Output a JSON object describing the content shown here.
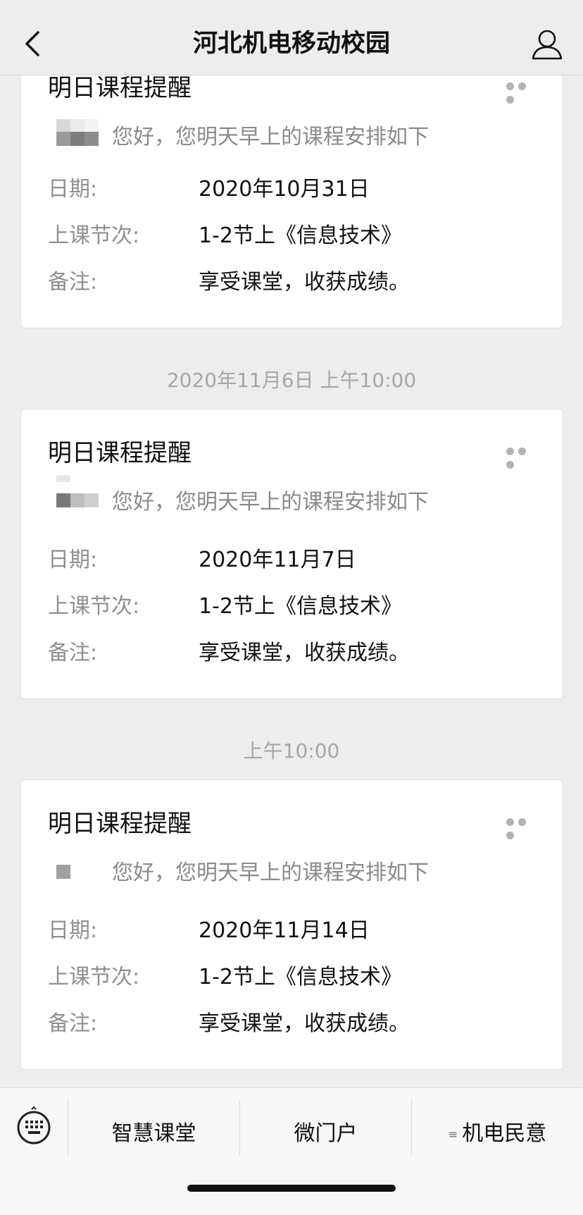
{
  "nav": {
    "title": "河北机电移动校园"
  },
  "messages": [
    {
      "title": "明日课程提醒",
      "greeting": "您好，您明天早上的课程安排如下",
      "date_label": "日期:",
      "date": "2020年10月31日",
      "session_label": "上课节次:",
      "session": "1-2节上《信息技术》",
      "note_label": "备注:",
      "note": "享受课堂，收获成绩。"
    },
    {
      "title": "明日课程提醒",
      "greeting": "您好，您明天早上的课程安排如下",
      "date_label": "日期:",
      "date": "2020年11月7日",
      "session_label": "上课节次:",
      "session": "1-2节上《信息技术》",
      "note_label": "备注:",
      "note": "享受课堂，收获成绩。"
    },
    {
      "title": "明日课程提醒",
      "greeting": "您好，您明天早上的课程安排如下",
      "date_label": "日期:",
      "date": "2020年11月14日",
      "session_label": "上课节次:",
      "session": "1-2节上《信息技术》",
      "note_label": "备注:",
      "note": "享受课堂，收获成绩。"
    }
  ],
  "timestamps": [
    "2020年11月6日 上午10:00",
    "上午10:00"
  ],
  "bottom_menu": {
    "items": [
      "智慧课堂",
      "微门户",
      "机电民意"
    ],
    "submenu_icon": "≡"
  },
  "icons": {
    "back": "chevron-left-icon",
    "user": "user-icon",
    "more": "more-dots-icon",
    "keyboard": "keyboard-icon"
  }
}
